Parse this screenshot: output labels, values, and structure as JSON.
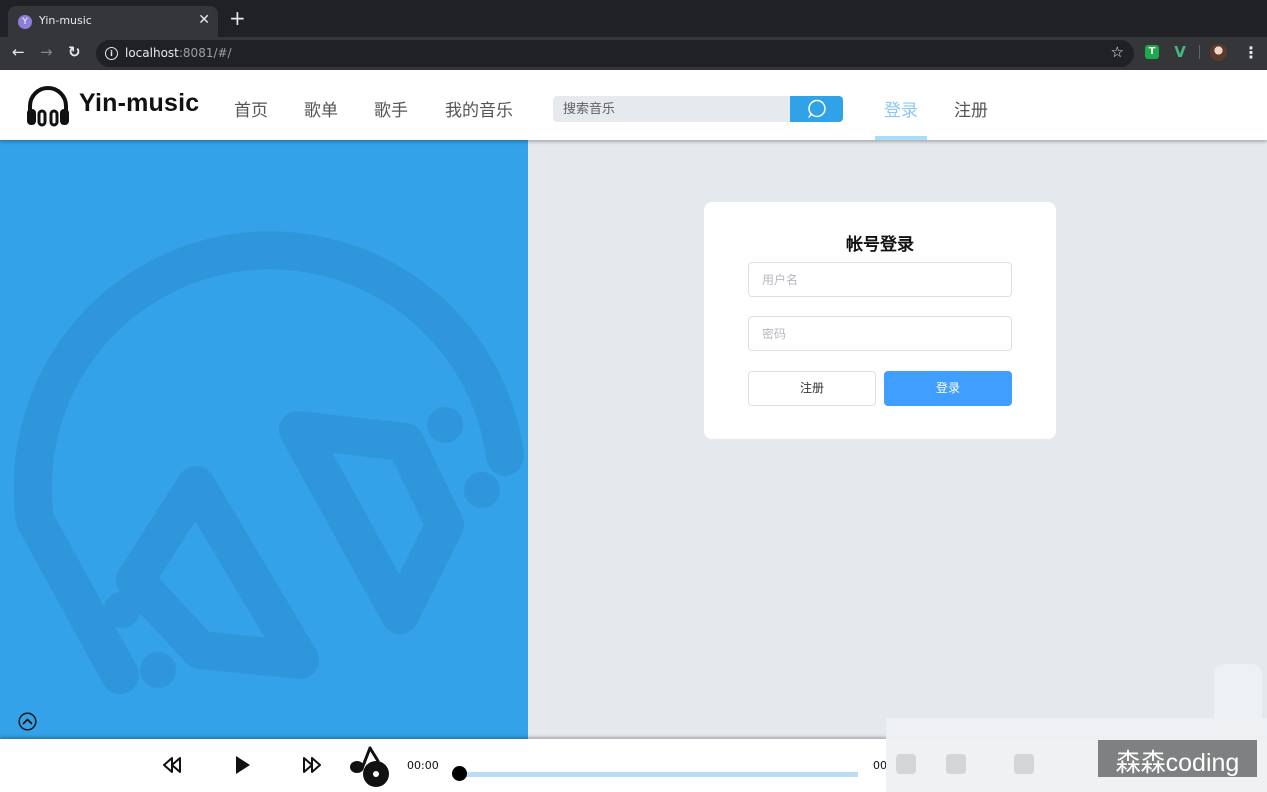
{
  "browser": {
    "tab_title": "Yin-music",
    "tab_favicon_letter": "Y",
    "url_host": "localhost",
    "url_rest": ":8081/#/"
  },
  "header": {
    "brand": "Yin-music",
    "nav": [
      "首页",
      "歌单",
      "歌手",
      "我的音乐"
    ],
    "search_placeholder": "搜索音乐",
    "login": "登录",
    "register": "注册"
  },
  "login_card": {
    "title": "帐号登录",
    "username_placeholder": "用户名",
    "password_placeholder": "密码",
    "register_button": "注册",
    "login_button": "登录"
  },
  "player": {
    "current_time": "00:00",
    "duration_partial": "00",
    "progress": 0
  },
  "watermark": "森森coding",
  "colors": {
    "accent": "#30a2e8",
    "login_button": "#409eff",
    "active_nav": "#8ec8ee"
  }
}
